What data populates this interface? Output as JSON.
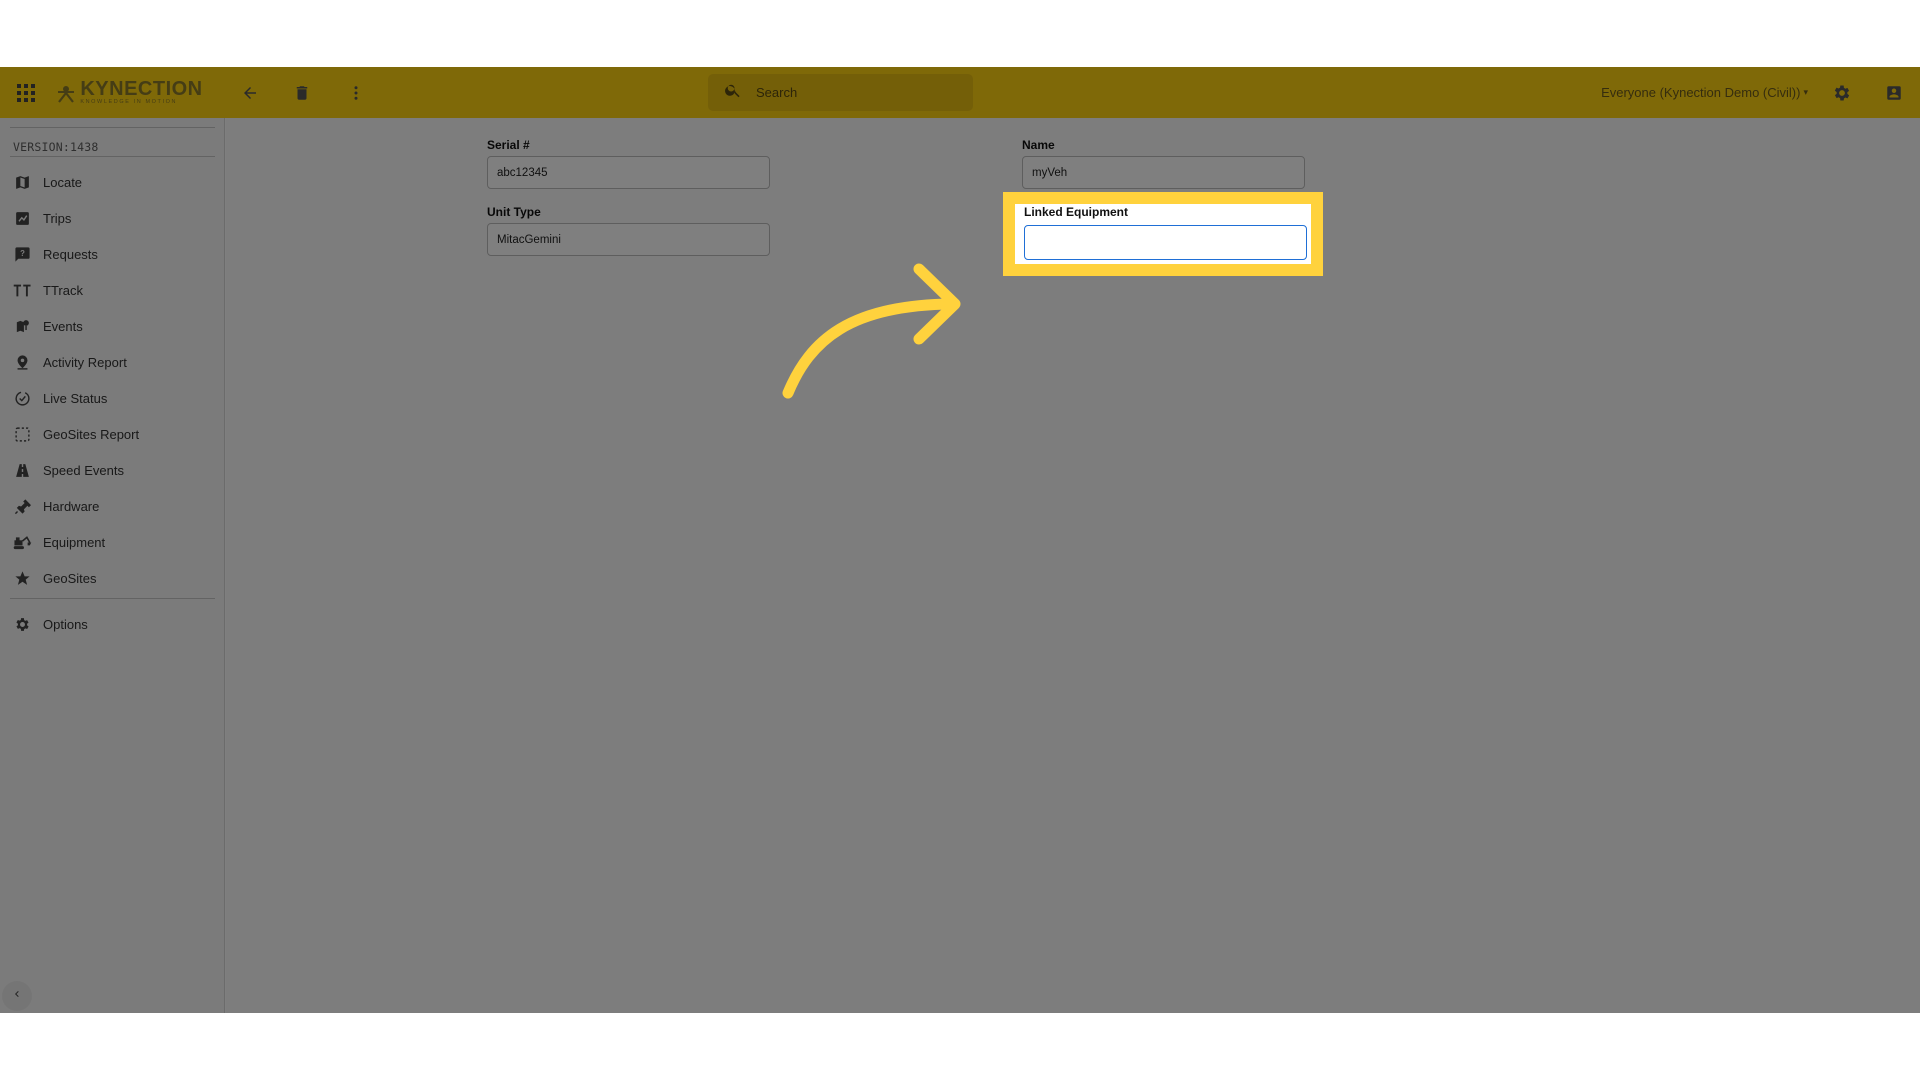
{
  "topbar": {
    "logo_text": "KYNECTION",
    "logo_tagline": "KNOWLEDGE IN MOTION",
    "search_placeholder": "Search",
    "org_selector": "Everyone (Kynection Demo (Civil))",
    "icons": [
      "apps-grid-icon",
      "back-arrow-icon",
      "trash-icon",
      "more-vert-icon",
      "search-icon",
      "gear-icon",
      "account-box-icon"
    ]
  },
  "sidebar": {
    "version": "VERSION:1438",
    "items": [
      {
        "label": "Locate",
        "icon": "map-icon"
      },
      {
        "label": "Trips",
        "icon": "trips-icon"
      },
      {
        "label": "Requests",
        "icon": "help-chat-icon"
      },
      {
        "label": "TTrack",
        "icon": "text-tt-icon"
      },
      {
        "label": "Events",
        "icon": "map-pin-icon"
      },
      {
        "label": "Activity Report",
        "icon": "person-pin-icon"
      },
      {
        "label": "Live Status",
        "icon": "check-circle-icon"
      },
      {
        "label": "GeoSites Report",
        "icon": "dashed-square-icon"
      },
      {
        "label": "Speed Events",
        "icon": "road-icon"
      },
      {
        "label": "Hardware",
        "icon": "plug-icon"
      },
      {
        "label": "Equipment",
        "icon": "excavator-icon"
      },
      {
        "label": "GeoSites",
        "icon": "star-icon"
      }
    ],
    "options": {
      "label": "Options",
      "icon": "gear-icon"
    }
  },
  "form": {
    "serial": {
      "label": "Serial #",
      "value": "abc12345"
    },
    "unit_type": {
      "label": "Unit Type",
      "value": "MitacGemini"
    },
    "name": {
      "label": "Name",
      "value": "myVeh"
    },
    "linked_equipment": {
      "label": "Linked Equipment",
      "value": ""
    }
  },
  "colors": {
    "brand_yellow": "#ffd211",
    "highlight_yellow": "#ffd23d",
    "focus_blue": "#1f6fd6"
  }
}
